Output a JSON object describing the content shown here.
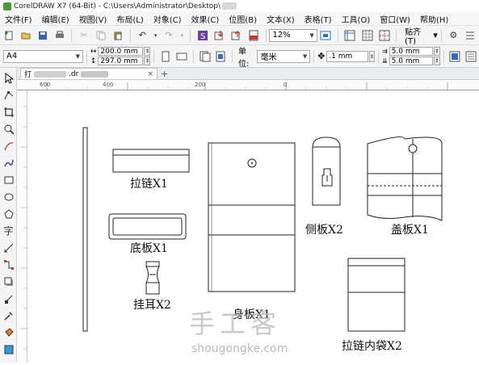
{
  "window": {
    "title": "CorelDRAW X7 (64-Bit) - C:\\Users\\Administrator\\Desktop\\"
  },
  "menu": [
    "文件(F)",
    "编辑(E)",
    "视图(V)",
    "布局(L)",
    "对象(C)",
    "效果(C)",
    "位图(B)",
    "文本(X)",
    "表格(T)",
    "工具(O)",
    "窗口(W)",
    "帮助(H)"
  ],
  "toolbar": {
    "zoom": "12%",
    "snap_label": "贴齐(T)"
  },
  "property_bar": {
    "page_size": "A4",
    "width": "200.0 mm",
    "height": "297.0 mm",
    "units_label": "单位:",
    "units_value": "毫米",
    "nudge": ".1 mm",
    "dup_x": "5.0 mm",
    "dup_y": "5.0 mm"
  },
  "document_tab": {
    "name_prefix": "打",
    "name_suffix": ".dr",
    "add": "+"
  },
  "ruler": {
    "labels": [
      "600",
      "400",
      "200",
      "0"
    ]
  },
  "pieces": {
    "zipper": "拉链X1",
    "bottom": "底板X1",
    "hanger": "挂耳X2",
    "body": "身板X1",
    "side": "侧板X2",
    "lid": "盖板X1",
    "zipper_pocket": "拉链内袋X2"
  },
  "watermark": {
    "cn": "手工客",
    "url": "shougongke.com"
  },
  "colors": {
    "chrome": "#f3f4f5",
    "accent": "#6b3fa0",
    "ruler": "#fbfbfb"
  }
}
